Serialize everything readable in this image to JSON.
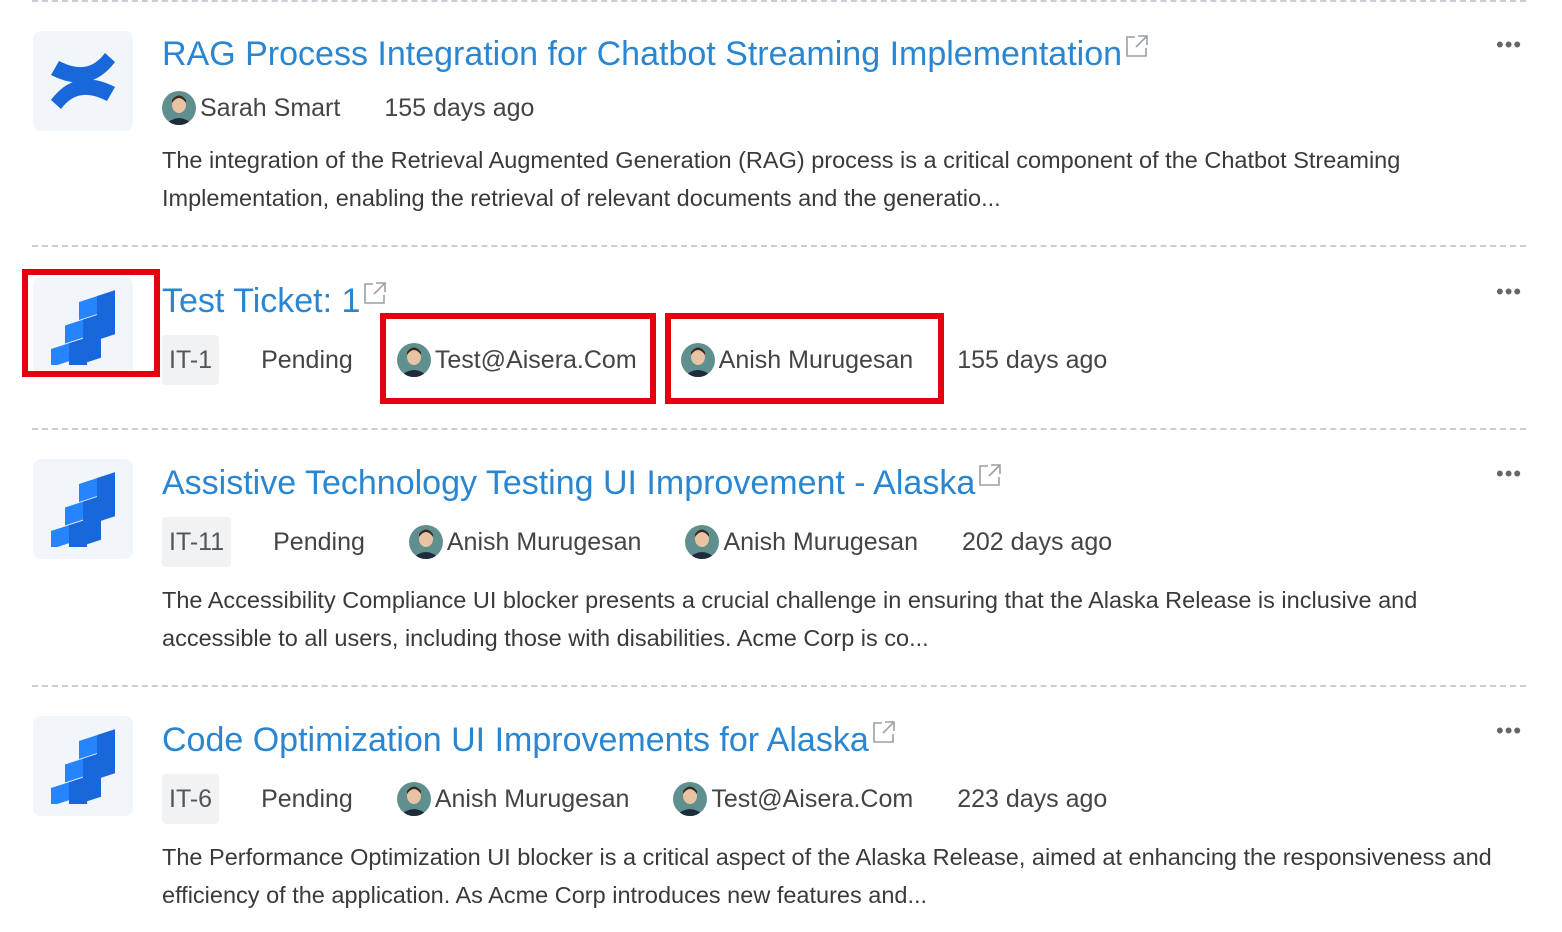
{
  "items": [
    {
      "icon": "confluence-icon",
      "title": "RAG Process Integration for Chatbot Streaming Implementation",
      "author": "Sarah Smart",
      "time": "155 days ago",
      "description": "The integration of the Retrieval Augmented Generation (RAG) process is a critical component of the Chatbot Streaming Implementation, enabling the retrieval of relevant documents and the generatio..."
    },
    {
      "icon": "jira-icon",
      "title": "Test Ticket: 1",
      "ticket_id": "IT-1",
      "status": "Pending",
      "reporter": "Test@Aisera.Com",
      "assignee": "Anish Murugesan",
      "time": "155 days ago"
    },
    {
      "icon": "jira-icon",
      "title": "Assistive Technology Testing UI Improvement - Alaska",
      "ticket_id": "IT-11",
      "status": "Pending",
      "reporter": "Anish Murugesan",
      "assignee": "Anish Murugesan",
      "time": "202 days ago",
      "description": "The Accessibility Compliance UI blocker presents a crucial challenge in ensuring that the Alaska Release is inclusive and accessible to all users, including those with disabilities. Acme Corp is co..."
    },
    {
      "icon": "jira-icon",
      "title": "Code Optimization UI Improvements for Alaska",
      "ticket_id": "IT-6",
      "status": "Pending",
      "reporter": "Anish Murugesan",
      "assignee": "Test@Aisera.Com",
      "time": "223 days ago",
      "description": "The Performance Optimization UI blocker is a critical aspect of the Alaska Release, aimed at enhancing the responsiveness and efficiency of the application. As Acme Corp introduces new features and..."
    }
  ],
  "more_label": "•••",
  "colors": {
    "link": "#2a86d1",
    "highlight": "#e3000f",
    "divider": "#c9ced6",
    "icon_bg": "#f2f6fb"
  }
}
